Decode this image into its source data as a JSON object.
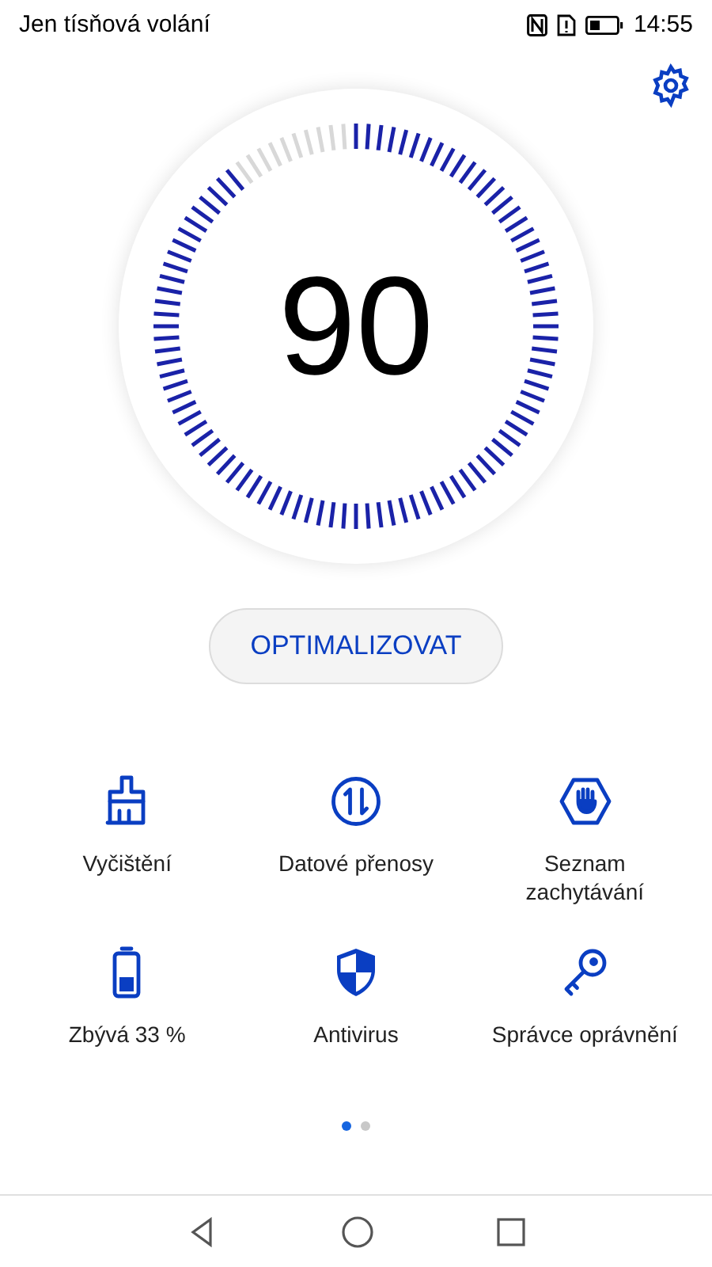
{
  "status_bar": {
    "carrier": "Jen tísňová volání",
    "time": "14:55"
  },
  "score": {
    "value": "90"
  },
  "optimize_button": "OPTIMALIZOVAT",
  "tools": [
    {
      "kind": "cleanup",
      "label": "Vyčištění"
    },
    {
      "kind": "data",
      "label": "Datové přenosy"
    },
    {
      "kind": "block",
      "label": "Seznam zachytávání"
    },
    {
      "kind": "battery",
      "label": "Zbývá 33 %"
    },
    {
      "kind": "antivirus",
      "label": "Antivirus"
    },
    {
      "kind": "permissions",
      "label": "Správce oprávnění"
    }
  ],
  "pages": [
    {
      "selected": true
    },
    {
      "selected": false
    }
  ]
}
